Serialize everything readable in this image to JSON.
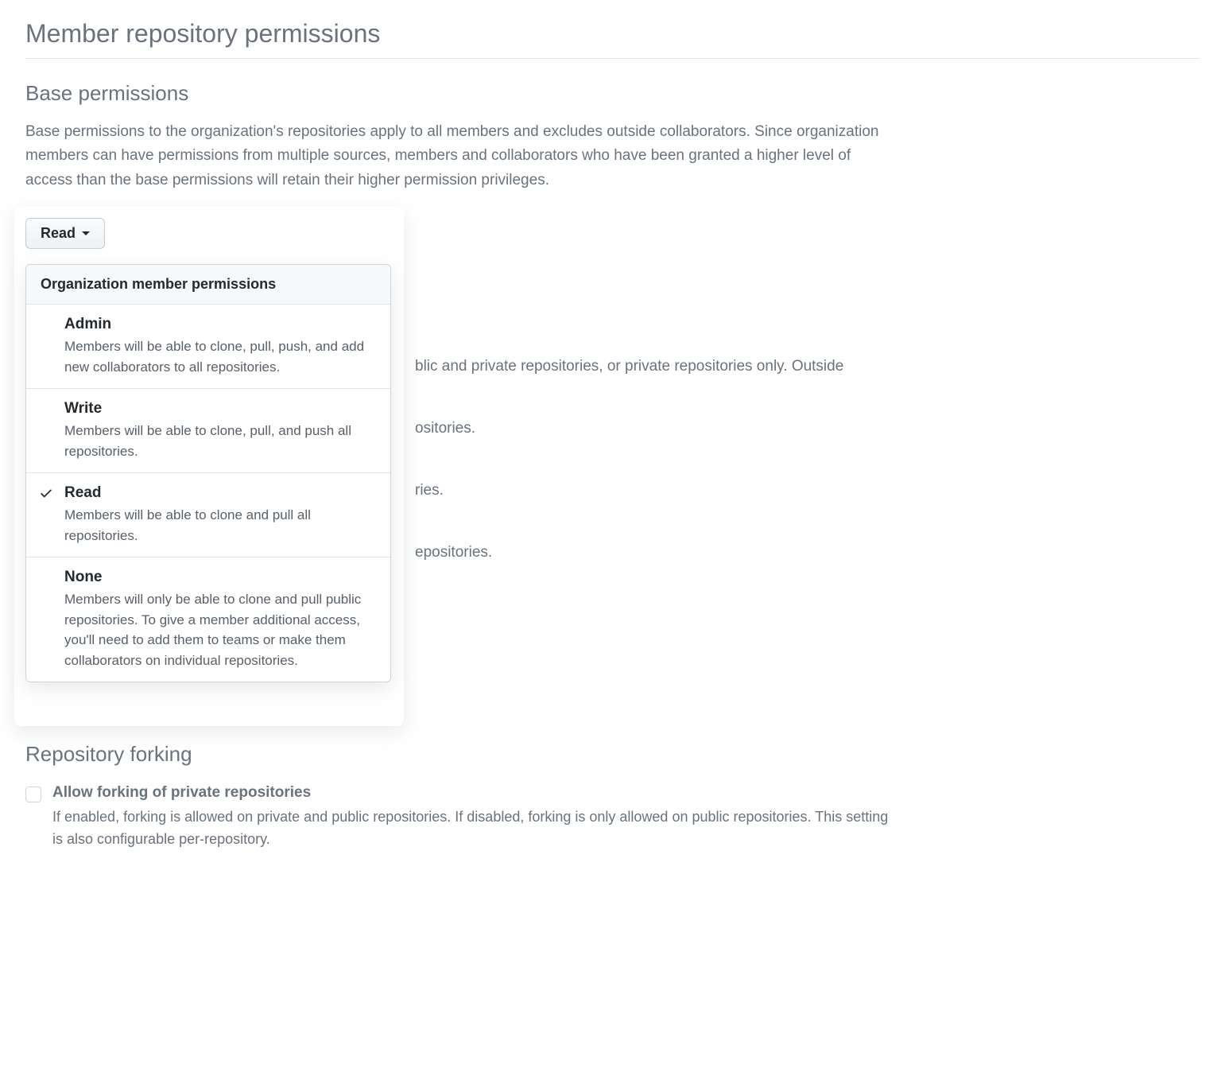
{
  "page_title": "Member repository permissions",
  "base_permissions": {
    "title": "Base permissions",
    "description": "Base permissions to the organization's repositories apply to all members and excludes outside collaborators. Since organization members can have permissions from multiple sources, members and collaborators who have been granted a higher level of access than the base permissions will retain their higher permission privileges.",
    "selected_label": "Read"
  },
  "dropdown": {
    "header": "Organization member permissions",
    "options": [
      {
        "title": "Admin",
        "description": "Members will be able to clone, pull, push, and add new collaborators to all repositories.",
        "selected": false
      },
      {
        "title": "Write",
        "description": "Members will be able to clone, pull, and push all repositories.",
        "selected": false
      },
      {
        "title": "Read",
        "description": "Members will be able to clone and pull all repositories.",
        "selected": true
      },
      {
        "title": "None",
        "description": "Members will only be able to clone and pull public repositories. To give a member additional access, you'll need to add them to teams or make them collaborators on individual repositories.",
        "selected": false
      }
    ]
  },
  "behind_text": {
    "repo_creation_desc_fragment": "blic and private repositories, or private repositories only. Outside",
    "opt1": "ositories.",
    "opt2": "ries.",
    "opt3": "epositories."
  },
  "repository_forking": {
    "title": "Repository forking",
    "checkbox_label": "Allow forking of private repositories",
    "checkbox_description": "If enabled, forking is allowed on private and public repositories. If disabled, forking is only allowed on public repositories. This setting is also configurable per-repository."
  }
}
